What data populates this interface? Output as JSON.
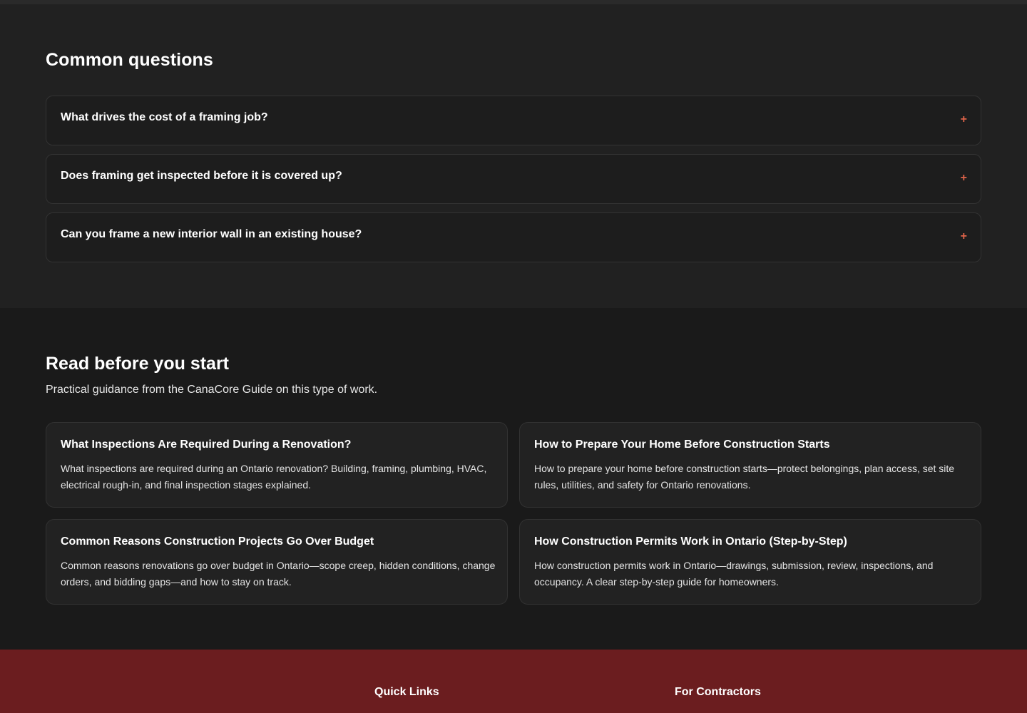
{
  "faq": {
    "title": "Common questions",
    "expand_symbol": "+",
    "items": [
      {
        "question": "What drives the cost of a framing job?"
      },
      {
        "question": "Does framing get inspected before it is covered up?"
      },
      {
        "question": "Can you frame a new interior wall in an existing house?"
      }
    ]
  },
  "guide": {
    "title": "Read before you start",
    "subtitle": "Practical guidance from the CanaCore Guide on this type of work.",
    "cards": [
      {
        "title": "What Inspections Are Required During a Renovation?",
        "description": "What inspections are required during an Ontario renovation? Building, framing, plumbing, HVAC, electrical rough-in, and final inspection stages explained."
      },
      {
        "title": "How to Prepare Your Home Before Construction Starts",
        "description": "How to prepare your home before construction starts—protect belongings, plan access, set site rules, utilities, and safety for Ontario renovations."
      },
      {
        "title": "Common Reasons Construction Projects Go Over Budget",
        "description": "Common reasons renovations go over budget in Ontario—scope creep, hidden conditions, change orders, and bidding gaps—and how to stay on track."
      },
      {
        "title": "How Construction Permits Work in Ontario (Step-by-Step)",
        "description": "How construction permits work in Ontario—drawings, submission, review, inspections, and occupancy. A clear step-by-step guide for homeowners."
      }
    ]
  },
  "footer": {
    "quick_links_heading": "Quick Links",
    "contractors_heading": "For Contractors"
  },
  "colors": {
    "accent": "#e0644a",
    "footer_bg": "#6b1d1f"
  }
}
